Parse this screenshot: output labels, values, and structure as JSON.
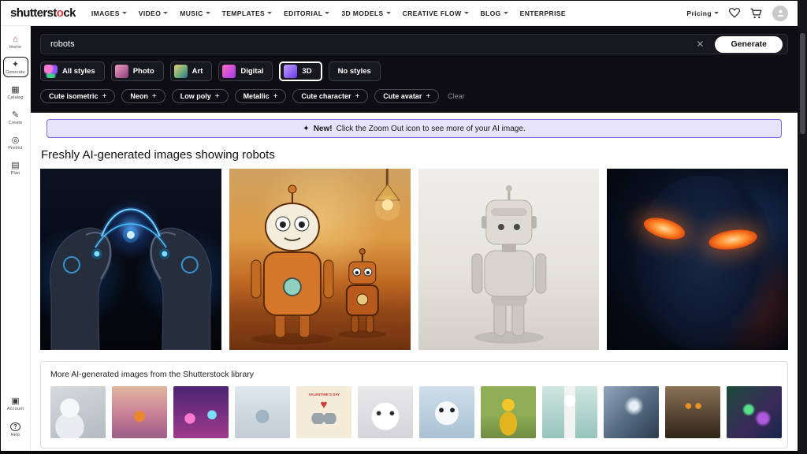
{
  "navbar": {
    "logo_pre": "shutterst",
    "logo_o": "o",
    "logo_post": "ck",
    "items": [
      {
        "label": "IMAGES"
      },
      {
        "label": "VIDEO"
      },
      {
        "label": "MUSIC"
      },
      {
        "label": "TEMPLATES"
      },
      {
        "label": "EDITORIAL"
      },
      {
        "label": "3D MODELS"
      },
      {
        "label": "CREATIVE FLOW"
      },
      {
        "label": "BLOG"
      },
      {
        "label": "ENTERPRISE"
      }
    ],
    "pricing_label": "Pricing"
  },
  "sidebar": {
    "items": [
      {
        "label": "Home",
        "icon": "home-icon"
      },
      {
        "label": "Generate",
        "icon": "sparkle-icon"
      },
      {
        "label": "Catalog",
        "icon": "grid-icon"
      },
      {
        "label": "Create",
        "icon": "pencil-icon"
      },
      {
        "label": "Predict",
        "icon": "target-icon"
      },
      {
        "label": "Plan",
        "icon": "board-icon"
      }
    ],
    "bottom_items": [
      {
        "label": "Account",
        "icon": "account-icon"
      },
      {
        "label": "Help",
        "icon": "help-icon"
      }
    ]
  },
  "prompt": {
    "value": "robots",
    "generate_label": "Generate"
  },
  "styles_row": {
    "chips": [
      {
        "label": "All styles"
      },
      {
        "label": "Photo"
      },
      {
        "label": "Art"
      },
      {
        "label": "Digital"
      },
      {
        "label": "3D",
        "selected": true
      },
      {
        "label": "No styles"
      }
    ]
  },
  "keywords_row": {
    "chips": [
      {
        "label": "Cute isometric"
      },
      {
        "label": "Neon"
      },
      {
        "label": "Low poly"
      },
      {
        "label": "Metallic"
      },
      {
        "label": "Cute character"
      },
      {
        "label": "Cute avatar"
      }
    ],
    "plus": "+",
    "clear_label": "Clear"
  },
  "banner": {
    "highlight": "New!",
    "text": "Click the Zoom Out icon to see more of your AI image."
  },
  "heading": "Freshly AI-generated images showing robots",
  "gallery": [
    {
      "alt": "Two chrome robot heads facing each other connected by blue neon wires"
    },
    {
      "alt": "Cartoon orange robots in a desert at sunset"
    },
    {
      "alt": "White minimalist robot standing in a bright room"
    },
    {
      "alt": "Dark robot face with glowing orange eyes"
    }
  ],
  "library": {
    "title": "More AI-generated images from the Shutterstock library",
    "valentine_caption": "VALENTINE'S DAY",
    "thumbs": [
      {
        "alt": "White robot working at a desk"
      },
      {
        "alt": "Small robot in a pink sunset scene"
      },
      {
        "alt": "Retro robots in a purple neon bar"
      },
      {
        "alt": "Robot silhouette in blue mist"
      },
      {
        "alt": "Valentine's Day robot greeting card"
      },
      {
        "alt": "White robot cat face"
      },
      {
        "alt": "Cute white robot head on blue background"
      },
      {
        "alt": "Yellow robot on green background"
      },
      {
        "alt": "White robot figure on a podium"
      },
      {
        "alt": "Chrome cyborg head with blue tones"
      },
      {
        "alt": "Rusty vintage robot"
      },
      {
        "alt": "Colorful cyberpunk robot face"
      }
    ]
  }
}
